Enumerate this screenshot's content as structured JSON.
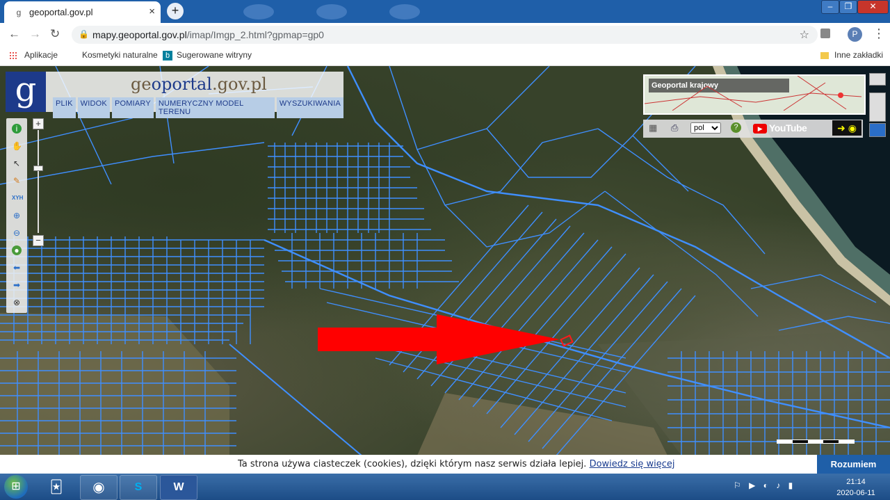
{
  "browser": {
    "tab_title": "geoportal.gov.pl",
    "tab_close": "×",
    "new_tab": "+",
    "url_host": "mapy.geoportal.gov.pl",
    "url_path": "/imap/Imgp_2.html?gpmap=gp0",
    "profile_initial": "P",
    "window_min": "–",
    "window_max": "❐",
    "window_close": "✕"
  },
  "bookmarks": {
    "apps": "Aplikacje",
    "item1": "Kosmetyki naturalne",
    "item2": "Sugerowane witryny",
    "other": "Inne zakładki"
  },
  "geoportal": {
    "logo": "g",
    "title_prefix": "ge",
    "title_mid": "oportal",
    "title_suffix": ".gov.pl",
    "menu": [
      "PLIK",
      "WIDOK",
      "POMIARY",
      "NUMERYCZNY MODEL TERENU",
      "WYSZUKIWANIA"
    ],
    "overview_label": "Geoportal krajowy",
    "lang_selected": "pol",
    "youtube": "YouTube"
  },
  "icons": {
    "tools": [
      "info-icon",
      "pan-hand-icon",
      "select-arrow-icon",
      "pencil-icon",
      "xyh-icon",
      "zoom-in-icon",
      "zoom-out-icon",
      "globe-icon",
      "back-arrow-icon",
      "forward-arrow-icon",
      "compass-icon"
    ],
    "xyh_label": "XYH"
  },
  "marker": {
    "color": "#ff0000"
  },
  "cookie": {
    "text": "Ta strona używa ciasteczek (cookies), dzięki którym nasz serwis działa lepiej.",
    "link": "Dowiedz się więcej",
    "button": "Rozumiem"
  },
  "taskbar": {
    "time": "21:14",
    "date": "2020-06-11",
    "word_label": "W"
  }
}
